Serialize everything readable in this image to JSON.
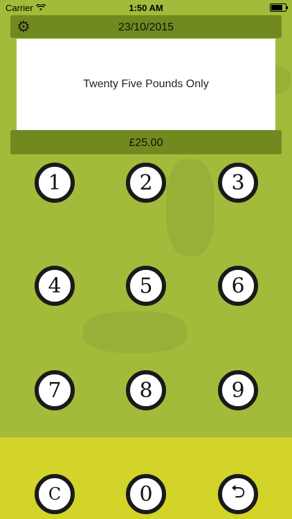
{
  "status_bar": {
    "carrier": "Carrier",
    "time": "1:50 AM",
    "battery_fraction": 0.9
  },
  "header": {
    "date": "23/10/2015",
    "settings_icon": "gear-icon"
  },
  "display": {
    "amount_words": "Twenty Five Pounds Only",
    "amount_value": "£25.00"
  },
  "keypad": {
    "keys": [
      "1",
      "2",
      "3",
      "4",
      "5",
      "6",
      "7",
      "8",
      "9",
      "C",
      "0",
      "⮌"
    ],
    "back_icon": "back-arrow-icon"
  },
  "colors": {
    "background": "#a3bb3a",
    "bar": "#708a1f",
    "lower_band": "#d2d42a"
  }
}
